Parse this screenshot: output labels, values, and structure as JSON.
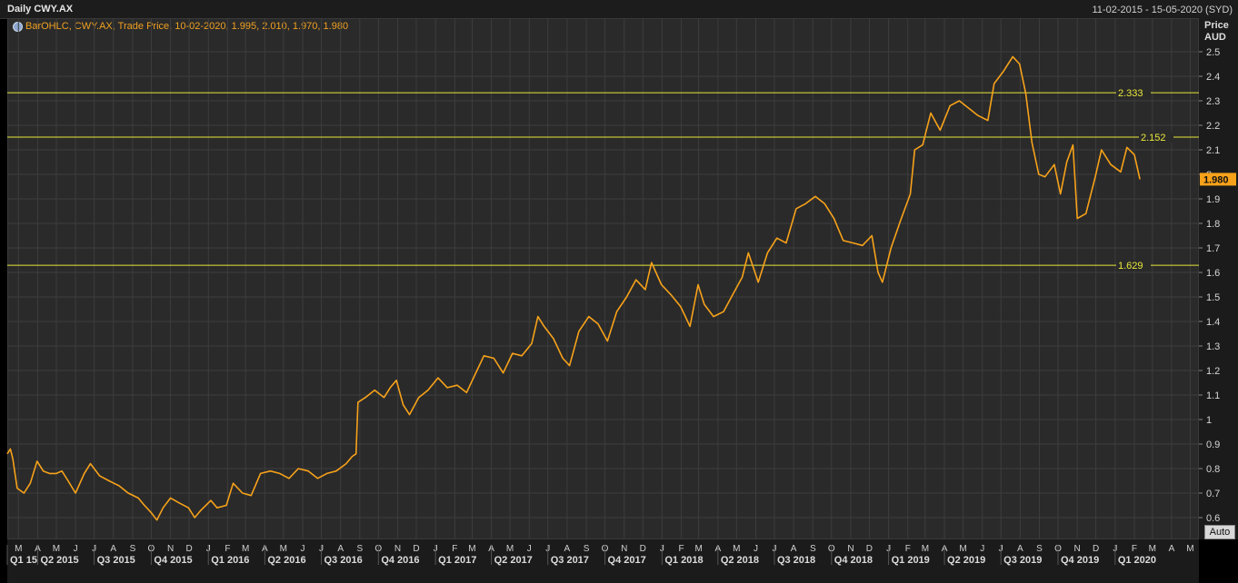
{
  "header": {
    "title": "Daily CWY.AX",
    "date_range": "11-02-2015 - 15-05-2020 (SYD)"
  },
  "legend": {
    "text": "BarOHLC, CWY.AX, Trade Price, 10-02-2020, 1.995, 2.010, 1.970, 1.980"
  },
  "axis": {
    "y_title_line1": "Price",
    "y_title_line2": "AUD",
    "auto_label": "Auto"
  },
  "colors": {
    "price": "#f7a21a",
    "hline": "#e8e83a",
    "grid": "#3d3d3d",
    "last_badge": "#f7a21a"
  },
  "chart_data": {
    "type": "line",
    "title": "Daily CWY.AX",
    "ylabel": "Price AUD",
    "ylim": [
      0.55,
      2.55
    ],
    "yticks": [
      0.6,
      0.7,
      0.8,
      0.9,
      1,
      1.1,
      1.2,
      1.3,
      1.4,
      1.5,
      1.6,
      1.7,
      1.8,
      1.9,
      2,
      2.1,
      2.2,
      2.3,
      2.4,
      2.5
    ],
    "ytick_labels": [
      "0.6",
      "0.7",
      "0.8",
      "0.9",
      "1",
      "1.1",
      "1.2",
      "1.3",
      "1.4",
      "1.5",
      "1.6",
      "1.7",
      "1.8",
      "1.9",
      "2",
      "2.1",
      "2.2",
      "2.3",
      "2.4",
      "2.5"
    ],
    "xlim": [
      "2015-02-11",
      "2020-05-15"
    ],
    "month_ticks": [
      {
        "date": "2015-03-01",
        "label": "M"
      },
      {
        "date": "2015-04-01",
        "label": "A"
      },
      {
        "date": "2015-05-01",
        "label": "M"
      },
      {
        "date": "2015-06-01",
        "label": "J"
      },
      {
        "date": "2015-07-01",
        "label": "J"
      },
      {
        "date": "2015-08-01",
        "label": "A"
      },
      {
        "date": "2015-09-01",
        "label": "S"
      },
      {
        "date": "2015-10-01",
        "label": "O"
      },
      {
        "date": "2015-11-01",
        "label": "N"
      },
      {
        "date": "2015-12-01",
        "label": "D"
      },
      {
        "date": "2016-01-01",
        "label": "J"
      },
      {
        "date": "2016-02-01",
        "label": "F"
      },
      {
        "date": "2016-03-01",
        "label": "M"
      },
      {
        "date": "2016-04-01",
        "label": "A"
      },
      {
        "date": "2016-05-01",
        "label": "M"
      },
      {
        "date": "2016-06-01",
        "label": "J"
      },
      {
        "date": "2016-07-01",
        "label": "J"
      },
      {
        "date": "2016-08-01",
        "label": "A"
      },
      {
        "date": "2016-09-01",
        "label": "S"
      },
      {
        "date": "2016-10-01",
        "label": "O"
      },
      {
        "date": "2016-11-01",
        "label": "N"
      },
      {
        "date": "2016-12-01",
        "label": "D"
      },
      {
        "date": "2017-01-01",
        "label": "J"
      },
      {
        "date": "2017-02-01",
        "label": "F"
      },
      {
        "date": "2017-03-01",
        "label": "M"
      },
      {
        "date": "2017-04-01",
        "label": "A"
      },
      {
        "date": "2017-05-01",
        "label": "M"
      },
      {
        "date": "2017-06-01",
        "label": "J"
      },
      {
        "date": "2017-07-01",
        "label": "J"
      },
      {
        "date": "2017-08-01",
        "label": "A"
      },
      {
        "date": "2017-09-01",
        "label": "S"
      },
      {
        "date": "2017-10-01",
        "label": "O"
      },
      {
        "date": "2017-11-01",
        "label": "N"
      },
      {
        "date": "2017-12-01",
        "label": "D"
      },
      {
        "date": "2018-01-01",
        "label": "J"
      },
      {
        "date": "2018-02-01",
        "label": "F"
      },
      {
        "date": "2018-03-01",
        "label": "M"
      },
      {
        "date": "2018-04-01",
        "label": "A"
      },
      {
        "date": "2018-05-01",
        "label": "M"
      },
      {
        "date": "2018-06-01",
        "label": "J"
      },
      {
        "date": "2018-07-01",
        "label": "J"
      },
      {
        "date": "2018-08-01",
        "label": "A"
      },
      {
        "date": "2018-09-01",
        "label": "S"
      },
      {
        "date": "2018-10-01",
        "label": "O"
      },
      {
        "date": "2018-11-01",
        "label": "N"
      },
      {
        "date": "2018-12-01",
        "label": "D"
      },
      {
        "date": "2019-01-01",
        "label": "J"
      },
      {
        "date": "2019-02-01",
        "label": "F"
      },
      {
        "date": "2019-03-01",
        "label": "M"
      },
      {
        "date": "2019-04-01",
        "label": "A"
      },
      {
        "date": "2019-05-01",
        "label": "M"
      },
      {
        "date": "2019-06-01",
        "label": "J"
      },
      {
        "date": "2019-07-01",
        "label": "J"
      },
      {
        "date": "2019-08-01",
        "label": "A"
      },
      {
        "date": "2019-09-01",
        "label": "S"
      },
      {
        "date": "2019-10-01",
        "label": "O"
      },
      {
        "date": "2019-11-01",
        "label": "N"
      },
      {
        "date": "2019-12-01",
        "label": "D"
      },
      {
        "date": "2020-01-01",
        "label": "J"
      },
      {
        "date": "2020-02-01",
        "label": "F"
      },
      {
        "date": "2020-03-01",
        "label": "M"
      },
      {
        "date": "2020-04-01",
        "label": "A"
      },
      {
        "date": "2020-05-01",
        "label": "M"
      }
    ],
    "quarter_labels": [
      {
        "date": "2015-02-11",
        "label": "Q1 15"
      },
      {
        "date": "2015-04-01",
        "label": "Q2 2015"
      },
      {
        "date": "2015-07-01",
        "label": "Q3 2015"
      },
      {
        "date": "2015-10-01",
        "label": "Q4 2015"
      },
      {
        "date": "2016-01-01",
        "label": "Q1 2016"
      },
      {
        "date": "2016-04-01",
        "label": "Q2 2016"
      },
      {
        "date": "2016-07-01",
        "label": "Q3 2016"
      },
      {
        "date": "2016-10-01",
        "label": "Q4 2016"
      },
      {
        "date": "2017-01-01",
        "label": "Q1 2017"
      },
      {
        "date": "2017-04-01",
        "label": "Q2 2017"
      },
      {
        "date": "2017-07-01",
        "label": "Q3 2017"
      },
      {
        "date": "2017-10-01",
        "label": "Q4 2017"
      },
      {
        "date": "2018-01-01",
        "label": "Q1 2018"
      },
      {
        "date": "2018-04-01",
        "label": "Q2 2018"
      },
      {
        "date": "2018-07-01",
        "label": "Q3 2018"
      },
      {
        "date": "2018-10-01",
        "label": "Q4 2018"
      },
      {
        "date": "2019-01-01",
        "label": "Q1 2019"
      },
      {
        "date": "2019-04-01",
        "label": "Q2 2019"
      },
      {
        "date": "2019-07-01",
        "label": "Q3 2019"
      },
      {
        "date": "2019-10-01",
        "label": "Q4 2019"
      },
      {
        "date": "2020-01-01",
        "label": "Q1 2020"
      }
    ],
    "horizontal_lines": [
      {
        "value": 2.333,
        "label": "2.333"
      },
      {
        "value": 2.152,
        "label": "2.152"
      },
      {
        "value": 1.629,
        "label": "1.629"
      }
    ],
    "last_price": {
      "value": 1.98,
      "label": "1.980"
    },
    "series": [
      {
        "points": [
          [
            "2015-02-11",
            0.86
          ],
          [
            "2015-02-16",
            0.88
          ],
          [
            "2015-02-20",
            0.84
          ],
          [
            "2015-02-27",
            0.72
          ],
          [
            "2015-03-10",
            0.7
          ],
          [
            "2015-03-20",
            0.74
          ],
          [
            "2015-03-31",
            0.83
          ],
          [
            "2015-04-10",
            0.79
          ],
          [
            "2015-04-20",
            0.78
          ],
          [
            "2015-05-01",
            0.78
          ],
          [
            "2015-05-10",
            0.79
          ],
          [
            "2015-05-20",
            0.75
          ],
          [
            "2015-06-01",
            0.7
          ],
          [
            "2015-06-15",
            0.78
          ],
          [
            "2015-06-25",
            0.82
          ],
          [
            "2015-07-10",
            0.77
          ],
          [
            "2015-07-25",
            0.75
          ],
          [
            "2015-08-10",
            0.73
          ],
          [
            "2015-08-25",
            0.7
          ],
          [
            "2015-09-10",
            0.68
          ],
          [
            "2015-09-20",
            0.65
          ],
          [
            "2015-10-01",
            0.62
          ],
          [
            "2015-10-10",
            0.59
          ],
          [
            "2015-10-20",
            0.64
          ],
          [
            "2015-11-01",
            0.68
          ],
          [
            "2015-11-15",
            0.66
          ],
          [
            "2015-11-30",
            0.64
          ],
          [
            "2015-12-10",
            0.6
          ],
          [
            "2015-12-20",
            0.63
          ],
          [
            "2016-01-05",
            0.67
          ],
          [
            "2016-01-15",
            0.64
          ],
          [
            "2016-01-30",
            0.65
          ],
          [
            "2016-02-10",
            0.74
          ],
          [
            "2016-02-25",
            0.7
          ],
          [
            "2016-03-10",
            0.69
          ],
          [
            "2016-03-25",
            0.78
          ],
          [
            "2016-04-10",
            0.79
          ],
          [
            "2016-04-25",
            0.78
          ],
          [
            "2016-05-10",
            0.76
          ],
          [
            "2016-05-25",
            0.8
          ],
          [
            "2016-06-10",
            0.79
          ],
          [
            "2016-06-25",
            0.76
          ],
          [
            "2016-07-10",
            0.78
          ],
          [
            "2016-07-25",
            0.79
          ],
          [
            "2016-08-10",
            0.82
          ],
          [
            "2016-08-20",
            0.85
          ],
          [
            "2016-08-26",
            0.86
          ],
          [
            "2016-08-29",
            1.07
          ],
          [
            "2016-09-10",
            1.09
          ],
          [
            "2016-09-25",
            1.12
          ],
          [
            "2016-10-10",
            1.09
          ],
          [
            "2016-10-20",
            1.13
          ],
          [
            "2016-10-30",
            1.16
          ],
          [
            "2016-11-10",
            1.06
          ],
          [
            "2016-11-20",
            1.02
          ],
          [
            "2016-12-05",
            1.09
          ],
          [
            "2016-12-20",
            1.12
          ],
          [
            "2017-01-05",
            1.17
          ],
          [
            "2017-01-20",
            1.13
          ],
          [
            "2017-02-05",
            1.14
          ],
          [
            "2017-02-20",
            1.11
          ],
          [
            "2017-03-05",
            1.18
          ],
          [
            "2017-03-20",
            1.26
          ],
          [
            "2017-04-05",
            1.25
          ],
          [
            "2017-04-20",
            1.19
          ],
          [
            "2017-05-05",
            1.27
          ],
          [
            "2017-05-20",
            1.26
          ],
          [
            "2017-06-05",
            1.31
          ],
          [
            "2017-06-15",
            1.42
          ],
          [
            "2017-06-25",
            1.38
          ],
          [
            "2017-07-10",
            1.33
          ],
          [
            "2017-07-25",
            1.25
          ],
          [
            "2017-08-05",
            1.22
          ],
          [
            "2017-08-20",
            1.36
          ],
          [
            "2017-09-05",
            1.42
          ],
          [
            "2017-09-20",
            1.39
          ],
          [
            "2017-10-05",
            1.32
          ],
          [
            "2017-10-20",
            1.44
          ],
          [
            "2017-11-05",
            1.5
          ],
          [
            "2017-11-20",
            1.57
          ],
          [
            "2017-12-05",
            1.53
          ],
          [
            "2017-12-15",
            1.64
          ],
          [
            "2017-12-31",
            1.55
          ],
          [
            "2018-01-15",
            1.51
          ],
          [
            "2018-01-31",
            1.46
          ],
          [
            "2018-02-15",
            1.38
          ],
          [
            "2018-02-28",
            1.55
          ],
          [
            "2018-03-10",
            1.47
          ],
          [
            "2018-03-25",
            1.42
          ],
          [
            "2018-04-10",
            1.44
          ],
          [
            "2018-04-25",
            1.51
          ],
          [
            "2018-05-10",
            1.58
          ],
          [
            "2018-05-20",
            1.68
          ],
          [
            "2018-06-05",
            1.56
          ],
          [
            "2018-06-20",
            1.68
          ],
          [
            "2018-07-05",
            1.74
          ],
          [
            "2018-07-20",
            1.72
          ],
          [
            "2018-08-05",
            1.86
          ],
          [
            "2018-08-20",
            1.88
          ],
          [
            "2018-09-05",
            1.91
          ],
          [
            "2018-09-20",
            1.88
          ],
          [
            "2018-10-05",
            1.82
          ],
          [
            "2018-10-20",
            1.73
          ],
          [
            "2018-11-05",
            1.72
          ],
          [
            "2018-11-20",
            1.71
          ],
          [
            "2018-12-05",
            1.75
          ],
          [
            "2018-12-15",
            1.6
          ],
          [
            "2018-12-22",
            1.56
          ],
          [
            "2019-01-05",
            1.7
          ],
          [
            "2019-01-20",
            1.81
          ],
          [
            "2019-02-05",
            1.92
          ],
          [
            "2019-02-12",
            2.1
          ],
          [
            "2019-02-25",
            2.12
          ],
          [
            "2019-03-10",
            2.25
          ],
          [
            "2019-03-25",
            2.18
          ],
          [
            "2019-04-10",
            2.28
          ],
          [
            "2019-04-25",
            2.3
          ],
          [
            "2019-05-10",
            2.27
          ],
          [
            "2019-05-25",
            2.24
          ],
          [
            "2019-06-10",
            2.22
          ],
          [
            "2019-06-20",
            2.37
          ],
          [
            "2019-07-05",
            2.42
          ],
          [
            "2019-07-20",
            2.48
          ],
          [
            "2019-07-31",
            2.45
          ],
          [
            "2019-08-10",
            2.33
          ],
          [
            "2019-08-20",
            2.13
          ],
          [
            "2019-08-31",
            2.0
          ],
          [
            "2019-09-10",
            1.99
          ],
          [
            "2019-09-25",
            2.04
          ],
          [
            "2019-10-05",
            1.92
          ],
          [
            "2019-10-15",
            2.05
          ],
          [
            "2019-10-25",
            2.12
          ],
          [
            "2019-11-01",
            1.82
          ],
          [
            "2019-11-15",
            1.84
          ],
          [
            "2019-11-30",
            1.99
          ],
          [
            "2019-12-10",
            2.1
          ],
          [
            "2019-12-25",
            2.04
          ],
          [
            "2020-01-10",
            2.01
          ],
          [
            "2020-01-20",
            2.11
          ],
          [
            "2020-02-01",
            2.08
          ],
          [
            "2020-02-10",
            1.98
          ]
        ]
      }
    ]
  }
}
